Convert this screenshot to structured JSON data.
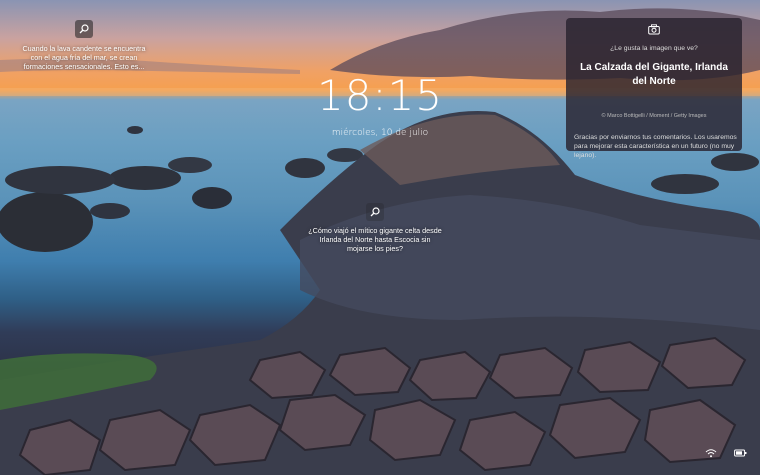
{
  "top_left_hint": {
    "icon": "search-lens-icon",
    "text": "Cuando la lava candente se encuentra con el agua fría del mar, se crean formaciones sensacionales. Esto es..."
  },
  "clock": {
    "time": "18:15",
    "date": "miércoles, 10 de julio"
  },
  "center_hint": {
    "icon": "search-lens-icon",
    "text": "¿Cómo viajó el mítico gigante celta desde Irlanda del Norte hasta Escocia sin mojarse los pies?"
  },
  "feedback_card": {
    "icon": "camera-icon",
    "question": "¿Le gusta la imagen que ve?",
    "title": "La Calzada del Gigante, Irlanda del Norte",
    "credit": "© Marco Bottigelli / Moment / Getty Images",
    "thanks": "Gracias por enviarnos tus comentarios. Los usaremos para mejorar esta característica en un futuro (no muy lejano)."
  },
  "system_tray": {
    "icons": [
      "wifi-icon",
      "battery-icon"
    ]
  }
}
